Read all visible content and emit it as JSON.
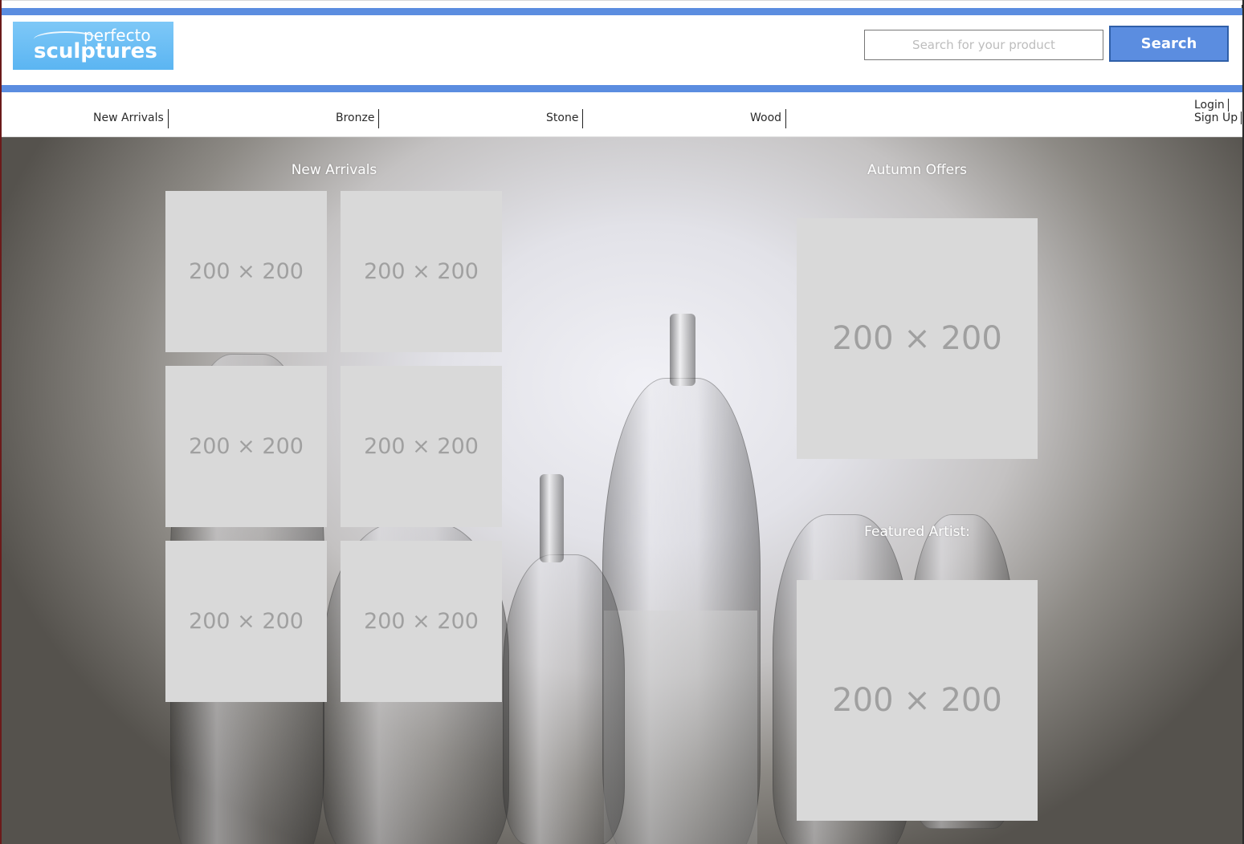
{
  "brand": {
    "logo_top": "perfecto",
    "logo_main": "sculptures"
  },
  "search": {
    "placeholder": "Search for your product",
    "value": "",
    "button_label": "Search"
  },
  "nav": {
    "items": [
      {
        "label": "New Arrivals"
      },
      {
        "label": "Bronze"
      },
      {
        "label": "Stone"
      },
      {
        "label": "Wood"
      }
    ],
    "login_label": "Login",
    "signup_label": "Sign Up"
  },
  "sections": {
    "new_arrivals": {
      "title": "New Arrivals",
      "tiles": [
        {
          "label": "200 × 200"
        },
        {
          "label": "200 × 200"
        },
        {
          "label": "200 × 200"
        },
        {
          "label": "200 × 200"
        },
        {
          "label": "200 × 200"
        },
        {
          "label": "200 × 200"
        }
      ]
    },
    "autumn_offers": {
      "title": "Autumn Offers",
      "tile_label": "200 × 200"
    },
    "featured_artist": {
      "title": "Featured Artist:",
      "tile_label": "200 × 200"
    }
  },
  "colors": {
    "accent_band": "#5b8de0",
    "placeholder_bg": "#d9d9d9",
    "placeholder_text": "#a0a0a0"
  }
}
